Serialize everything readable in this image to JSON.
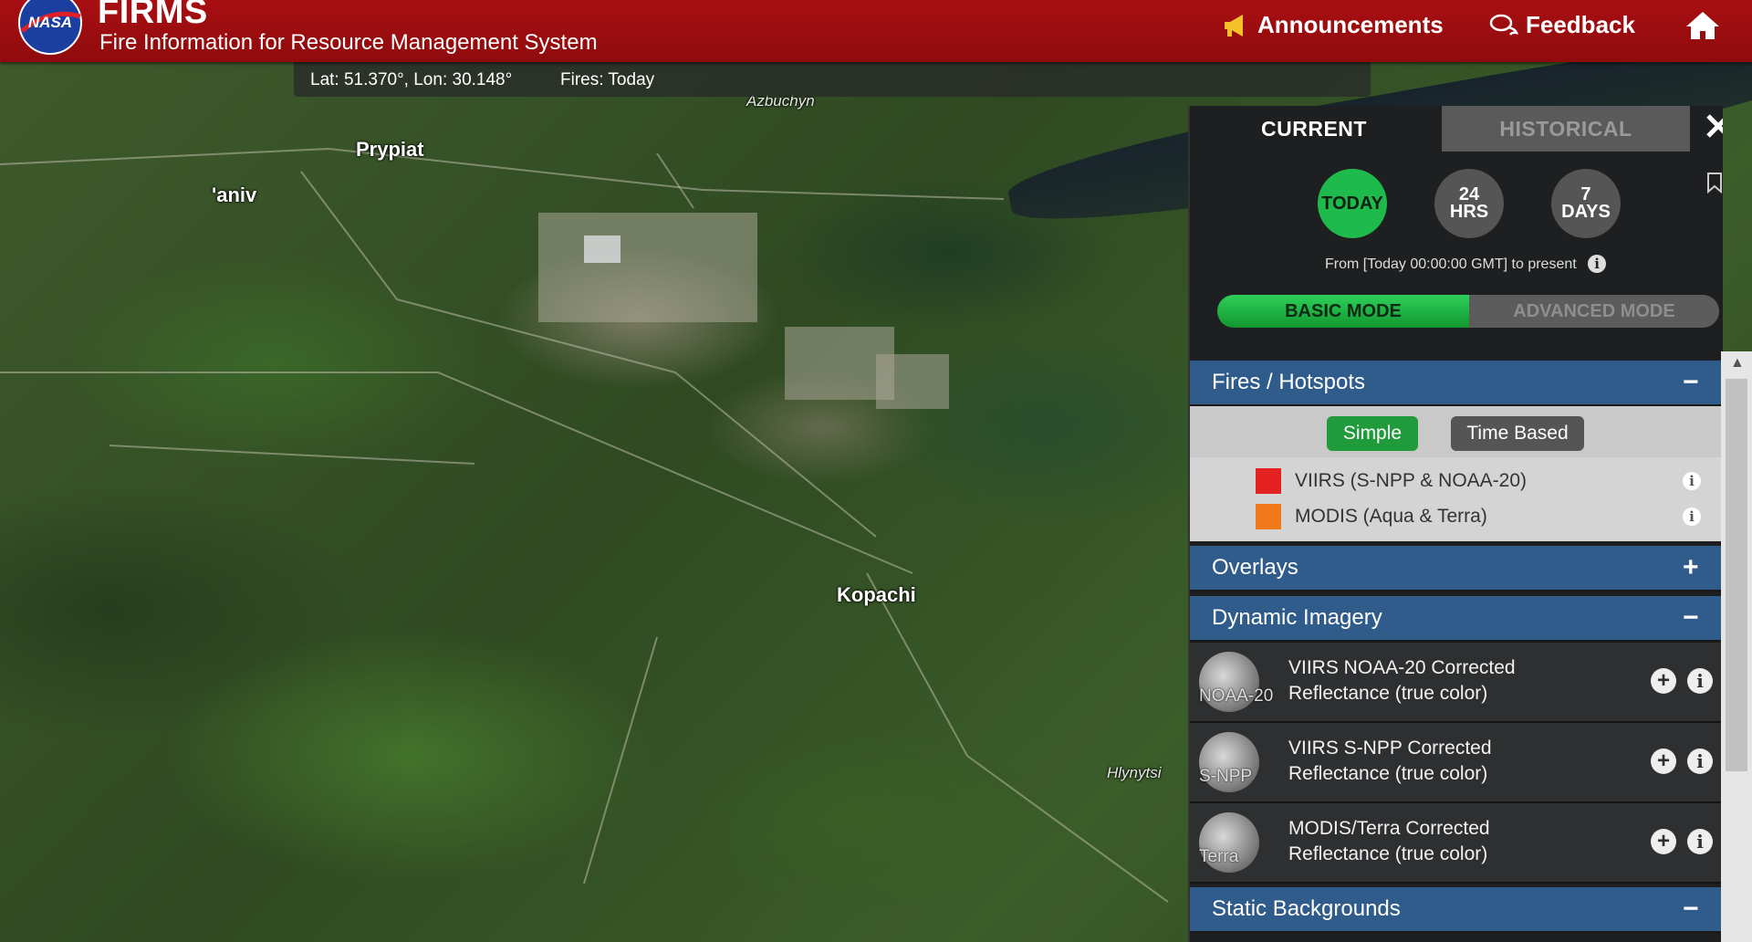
{
  "header": {
    "logo_text": "NASA",
    "title": "FIRMS",
    "subtitle": "Fire Information for Resource Management System",
    "nav": [
      {
        "label": "Announcements",
        "icon": "megaphone-icon"
      },
      {
        "label": "Feedback",
        "icon": "chat-icon"
      },
      {
        "label": "",
        "icon": "home-icon"
      }
    ]
  },
  "status": {
    "coords": "Lat: 51.370°, Lon: 30.148°",
    "fires": "Fires: Today"
  },
  "map_labels": {
    "prypiat": "Prypiat",
    "yaniv": "'aniv",
    "kopachi": "Kopachi",
    "azbuchyn": "Azbuchyn",
    "hlynytsi": "Hlynytsi"
  },
  "panel": {
    "tabs": {
      "current": "CURRENT",
      "historical": "HISTORICAL"
    },
    "time_buttons": {
      "today": "TODAY",
      "hrs_num": "24",
      "hrs_unit": "HRS",
      "days_num": "7",
      "days_unit": "DAYS"
    },
    "time_note": "From [Today 00:00:00 GMT] to present",
    "modes": {
      "basic": "BASIC MODE",
      "advanced": "ADVANCED MODE"
    },
    "fires_section": {
      "title": "Fires / Hotspots",
      "toggle": "−",
      "subtabs": {
        "simple": "Simple",
        "time_based": "Time Based"
      },
      "layers": [
        {
          "label": "VIIRS (S-NPP & NOAA-20)",
          "color": "#e52222"
        },
        {
          "label": "MODIS (Aqua & Terra)",
          "color": "#f07a1a"
        }
      ]
    },
    "overlays_section": {
      "title": "Overlays",
      "toggle": "+"
    },
    "imagery_section": {
      "title": "Dynamic Imagery",
      "toggle": "−",
      "items": [
        {
          "thumb": "NOAA-20",
          "line1": "VIIRS NOAA-20 Corrected",
          "line2": "Reflectance (true color)"
        },
        {
          "thumb": "S-NPP",
          "line1": "VIIRS S-NPP Corrected",
          "line2": "Reflectance (true color)"
        },
        {
          "thumb": "Terra",
          "line1": "MODIS/Terra Corrected",
          "line2": "Reflectance (true color)"
        }
      ]
    },
    "static_section": {
      "title": "Static Backgrounds",
      "toggle": "−"
    }
  },
  "colors": {
    "header": "#a80f12",
    "accent_green": "#1fba4c",
    "section_blue": "#2f5c8a"
  }
}
